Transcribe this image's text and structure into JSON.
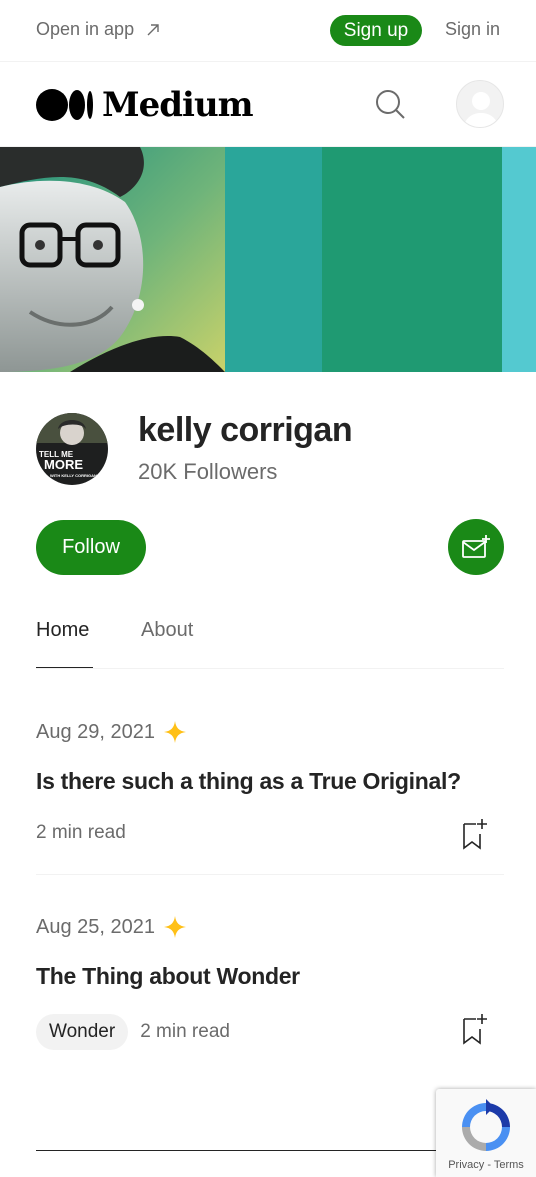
{
  "topbar": {
    "open_app": "Open in app",
    "sign_up": "Sign up",
    "sign_in": "Sign in"
  },
  "header": {
    "logo_text": "Medium"
  },
  "profile": {
    "name": "kelly corrigan",
    "followers": "20K Followers",
    "avatar_text_line1": "TELL ME",
    "avatar_text_line2": "MORE",
    "avatar_text_line3": "WITH KELLY CORRIGAN",
    "follow_label": "Follow"
  },
  "tabs": [
    {
      "label": "Home",
      "active": true
    },
    {
      "label": "About",
      "active": false
    }
  ],
  "articles": [
    {
      "date": "Aug 29, 2021",
      "member_only": true,
      "title": "Is there such a thing as a True Original?",
      "tag": "",
      "read_time": "2 min read"
    },
    {
      "date": "Aug 25, 2021",
      "member_only": true,
      "title": "The Thing about Wonder",
      "tag": "Wonder",
      "read_time": "2 min read"
    }
  ],
  "recaptcha": {
    "privacy": "Privacy",
    "separator": "-",
    "terms": "Terms"
  },
  "colors": {
    "brand_green": "#1a8917",
    "text_primary": "#242424",
    "text_secondary": "#6b6b6b",
    "star_gold": "#ffc017"
  }
}
